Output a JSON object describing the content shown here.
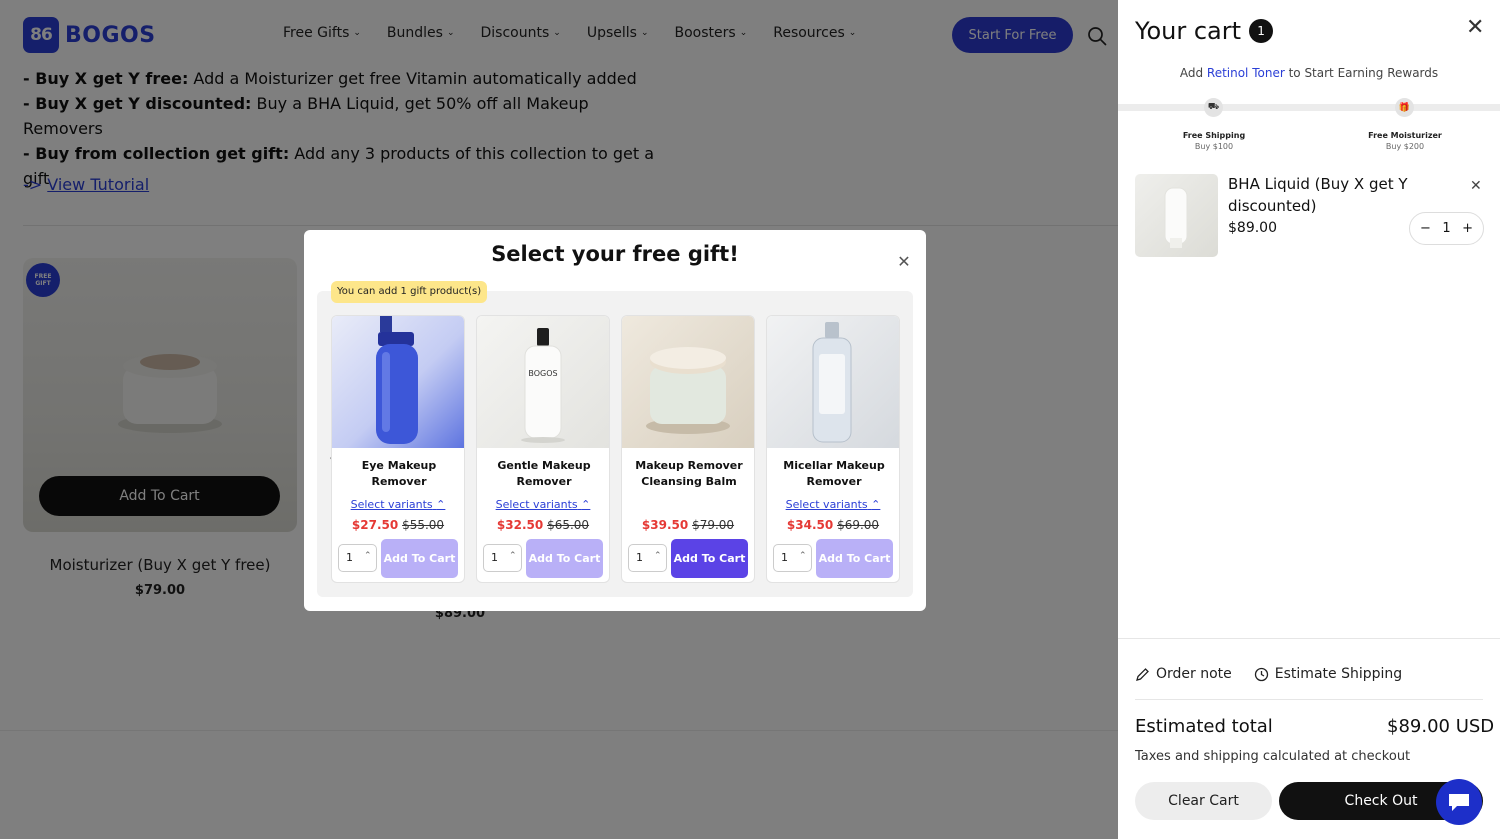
{
  "header": {
    "logo_mark": "86",
    "logo_text": "BOGOS",
    "nav": [
      {
        "label": "Free Gifts"
      },
      {
        "label": "Bundles"
      },
      {
        "label": "Discounts"
      },
      {
        "label": "Upsells"
      },
      {
        "label": "Boosters"
      },
      {
        "label": "Resources"
      }
    ],
    "start_label": "Start For Free"
  },
  "promo": {
    "lines": [
      {
        "bold": "- Buy X get Y free:",
        "text": " Add a Moisturizer get free Vitamin automatically added"
      },
      {
        "bold": "- Buy X get Y discounted:",
        "text": " Buy a BHA Liquid, get 50% off all Makeup Removers"
      },
      {
        "bold": "- Buy from collection get gift:",
        "text": " Add any 3 products of this collection to get a gift"
      }
    ],
    "tutorial_prefix": "-> ",
    "tutorial_label": "View Tutorial"
  },
  "products": {
    "card1": {
      "badge": "FREE GIFT",
      "button": "Add To Cart",
      "title": "Moisturizer (Buy X get Y free)",
      "price": "$79.00"
    },
    "card2": {
      "price": "$89.00"
    }
  },
  "modal": {
    "title": "Select your free gift!",
    "limit_note": "You can add 1 gift product(s)",
    "gifts": [
      {
        "name": "Eye Makeup Remover",
        "variants": "Select variants",
        "sale": "$27.50",
        "old": "$55.00",
        "qty": "1",
        "button": "Add To Cart",
        "active": false
      },
      {
        "name": "Gentle Makeup Remover",
        "variants": "Select variants",
        "sale": "$32.50",
        "old": "$65.00",
        "qty": "1",
        "button": "Add To Cart",
        "active": false,
        "bottle_text": "BOGOS"
      },
      {
        "name": "Makeup Remover Cleansing Balm",
        "variants": "",
        "sale": "$39.50",
        "old": "$79.00",
        "qty": "1",
        "button": "Add To Cart",
        "active": true
      },
      {
        "name": "Micellar Makeup Remover",
        "variants": "Select variants",
        "sale": "$34.50",
        "old": "$69.00",
        "qty": "1",
        "button": "Add To Cart",
        "active": false
      }
    ]
  },
  "cart": {
    "title": "Your cart",
    "count": "1",
    "reward_prefix": "Add ",
    "reward_product": "Retinol Toner",
    "reward_suffix": " to Start Earning Rewards",
    "milestones": [
      {
        "label": "Free Shipping",
        "sub": "Buy $100"
      },
      {
        "label": "Free Moisturizer",
        "sub": "Buy $200"
      }
    ],
    "item": {
      "name": "BHA Liquid (Buy X get Y discounted)",
      "price": "$89.00",
      "qty": "1",
      "minus": "−",
      "plus": "+"
    },
    "order_note": "Order note",
    "estimate_shipping": "Estimate Shipping",
    "estimated_label": "Estimated total",
    "estimated_value": "$89.00 USD",
    "tax_note": "Taxes and shipping calculated at checkout",
    "clear_label": "Clear Cart",
    "checkout_label": "Check Out"
  },
  "colors": {
    "brand": "#2b3fd6",
    "gift_button_active": "#5b43e6",
    "gift_button_inactive": "#b9b0f7",
    "sale_price": "#e53935",
    "limit_note_bg": "#fde68a"
  }
}
